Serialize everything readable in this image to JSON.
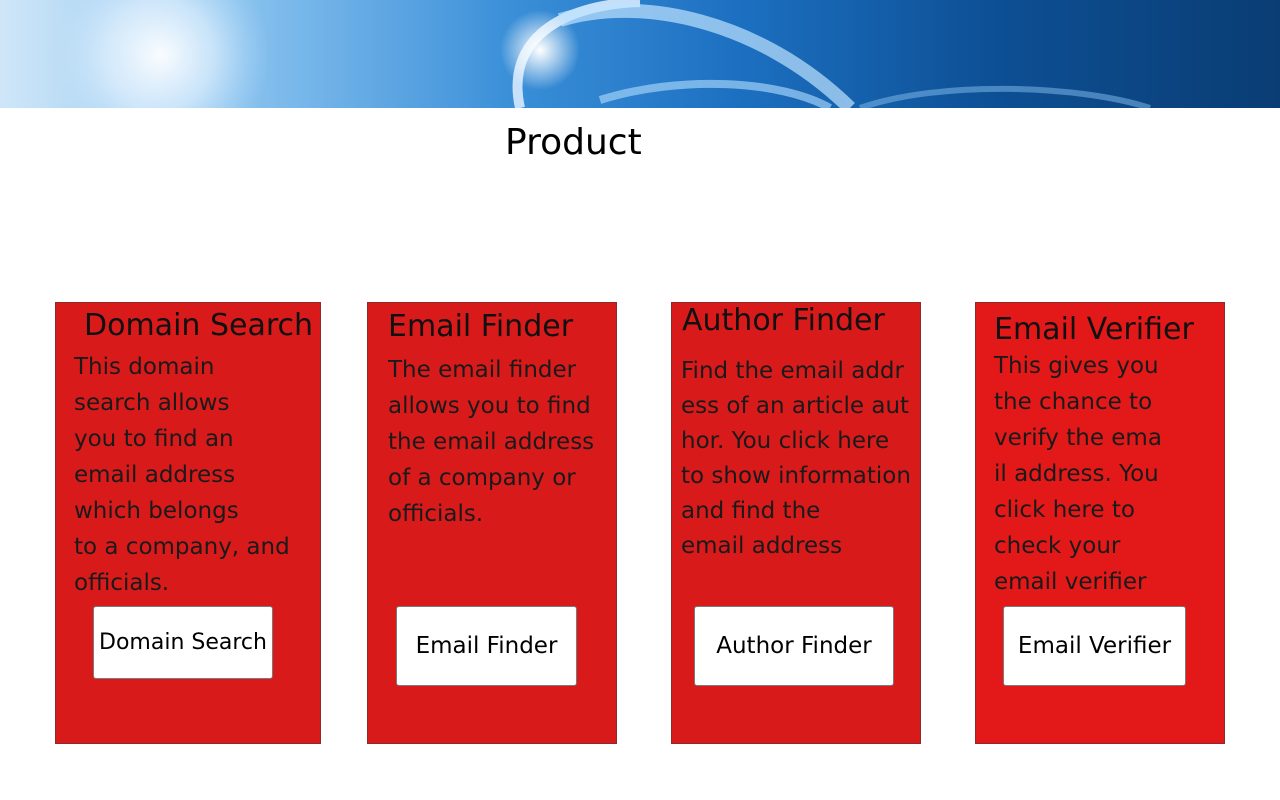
{
  "page": {
    "title": "Product"
  },
  "cards": [
    {
      "title": "Domain Search",
      "description_lines": [
        "This domain",
        "search allows",
        "you to find an",
        "email address",
        "which belongs",
        "to a company, and",
        "officials."
      ],
      "button_label": "Domain Search"
    },
    {
      "title": "Email Finder",
      "description_lines": [
        "The email finder",
        "allows you to find",
        "the email address",
        "of a company or",
        "officials."
      ],
      "button_label": "Email Finder"
    },
    {
      "title": "Author Finder",
      "description_lines": [
        "Find the email addr",
        "ess of an article aut",
        "hor. You click here",
        "to show information",
        "and find the",
        "email address"
      ],
      "button_label": "Author Finder"
    },
    {
      "title": "Email Verifier",
      "description_lines": [
        "This gives you",
        "the chance to",
        "verify the ema",
        "il address. You",
        "click here to",
        "check your",
        "email verifier"
      ],
      "button_label": "Email Verifier"
    }
  ],
  "colors": {
    "card_background": "#d91a1a",
    "card_background_alt": "#e31919",
    "button_background": "#ffffff"
  }
}
